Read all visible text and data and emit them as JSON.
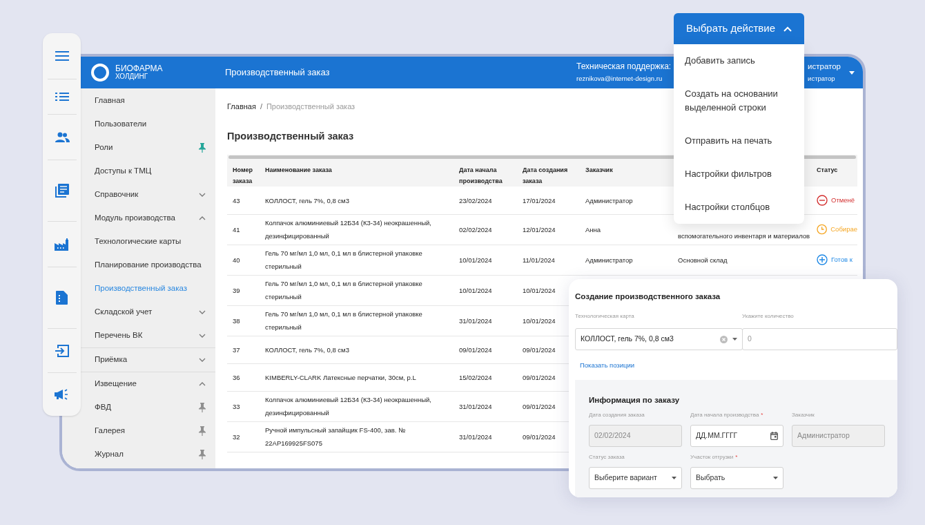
{
  "action_button": {
    "label": "Выбрать действие",
    "expanded": true
  },
  "action_menu": [
    "Добавить запись",
    "Создать на основании выделенной строки",
    "Отправить на печать",
    "Настройки фильтров",
    "Настройки столбцов"
  ],
  "app": {
    "logo": {
      "name": "БИОФАРМА",
      "subtitle": "ХОЛДИНГ"
    },
    "header_title": "Производственный заказ",
    "support": {
      "label": "Техническая поддержка:",
      "email": "reznikova@internet-design.ru"
    },
    "user": {
      "name": "истратор",
      "role": "истратор"
    }
  },
  "sidebar": {
    "items": [
      {
        "label": "Главная",
        "selected": false
      },
      {
        "label": "Пользователи",
        "selected": false
      },
      {
        "label": "Роли",
        "selected": false,
        "kind": "pin",
        "pinned": true
      },
      {
        "label": "Доступы к ТМЦ",
        "selected": false
      },
      {
        "label": "Справочник",
        "selected": false,
        "kind": "chevron",
        "expanded": false
      },
      {
        "label": "Модуль производства",
        "selected": false,
        "kind": "chevron",
        "expanded": true
      },
      {
        "label": "Технологические карты",
        "selected": false
      },
      {
        "label": "Планирование производства",
        "selected": false
      },
      {
        "label": "Производственный заказ",
        "selected": true
      },
      {
        "label": "Складской учет",
        "selected": false,
        "kind": "chevron",
        "expanded": false
      },
      {
        "label": "Перечень ВК",
        "selected": false,
        "kind": "chevron",
        "expanded": false
      },
      {
        "label": "Приёмка",
        "selected": false,
        "kind": "chevron",
        "expanded": false,
        "divider_above": true
      },
      {
        "label": "Извещение",
        "selected": false,
        "kind": "chevron",
        "expanded": true,
        "divider_above": true
      },
      {
        "label": "ФВД",
        "selected": false,
        "kind": "pin",
        "pinned": false
      },
      {
        "label": "Галерея",
        "selected": false,
        "kind": "pin",
        "pinned": false
      },
      {
        "label": "Журнал",
        "selected": false,
        "kind": "pin",
        "pinned": false
      }
    ]
  },
  "breadcrumb": [
    "Главная",
    "Производственный заказ"
  ],
  "breadcrumb_separator": "/",
  "page_title": "Производственный заказ",
  "table": {
    "columns": [
      "Номер заказа",
      "Наименование заказа",
      "Дата начала производства",
      "Дата создания заказа",
      "Заказчик",
      null,
      "Статус"
    ],
    "rows": [
      {
        "number": "43",
        "name": "КОЛЛОСТ, гель 7%, 0,8 см3",
        "start": "23/02/2024",
        "created": "17/01/2024",
        "customer": "Администратор",
        "status": {
          "label": "Отменё",
          "kind": "cancelled"
        }
      },
      {
        "number": "41",
        "name": "Колпачок алюминиевый 12Б34 (К3-34) неокрашенный, дезинфицированный",
        "start": "02/02/2024",
        "created": "12/01/2024",
        "customer": "Анна",
        "column_6": "вспомогательного инвентаря и материалов",
        "status": {
          "label": "Собирае",
          "kind": "collecting"
        }
      },
      {
        "number": "40",
        "name": "Гель 70 мг/мл 1,0 мл, 0,1 мл в блистерной упаковке стерильный",
        "start": "10/01/2024",
        "created": "11/01/2024",
        "customer": "Администратор",
        "column_6": "Основной склад",
        "status": {
          "label": "Готов к",
          "kind": "ready"
        }
      },
      {
        "number": "39",
        "name": "Гель 70 мг/мл 1,0 мл, 0,1 мл в блистерной упаковке стерильный",
        "start": "10/01/2024",
        "created": "10/01/2024"
      },
      {
        "number": "38",
        "name": "Гель 70 мг/мл 1,0 мл, 0,1 мл в блистерной упаковке стерильный",
        "start": "31/01/2024",
        "created": "10/01/2024"
      },
      {
        "number": "37",
        "name": "КОЛЛОСТ, гель 7%, 0,8 см3",
        "start": "09/01/2024",
        "created": "09/01/2024"
      },
      {
        "number": "36",
        "name": "KIMBERLY-CLARK Латексные перчатки, 30см, p.L",
        "start": "15/02/2024",
        "created": "09/01/2024"
      },
      {
        "number": "33",
        "name": "Колпачок алюминиевый 12Б34 (К3-34) неокрашенный, дезинфицированный",
        "start": "31/01/2024",
        "created": "09/01/2024"
      },
      {
        "number": "32",
        "name": "Ручной импульсный запайщик FS-400, зав. № 22AP169925FS075",
        "start": "31/01/2024",
        "created": "09/01/2024"
      }
    ]
  },
  "form": {
    "title": "Создание производственного заказа",
    "tech_card": {
      "label": "Технологическая карта",
      "value": "КОЛЛОСТ, гель 7%, 0,8 см3"
    },
    "quantity": {
      "label": "Укажите количество",
      "value": "0"
    },
    "link": "Показать позиции",
    "section_title": "Информация по заказу",
    "fields": [
      {
        "label": "Дата создания заказа",
        "value": "02/02/2024",
        "kind": "readonly"
      },
      {
        "label": "Дата начала производства",
        "placeholder": "ДД.ММ.ГГГГ",
        "kind": "date",
        "required_mark": "*"
      },
      {
        "label": "Заказчик",
        "value": "Администратор",
        "kind": "readonly"
      },
      {
        "label": "Статус заказа",
        "value": "Выберите вариант",
        "kind": "select"
      },
      {
        "label": "Участок отгрузки",
        "value": "Выбрать",
        "kind": "select",
        "required_mark": "*"
      }
    ]
  }
}
